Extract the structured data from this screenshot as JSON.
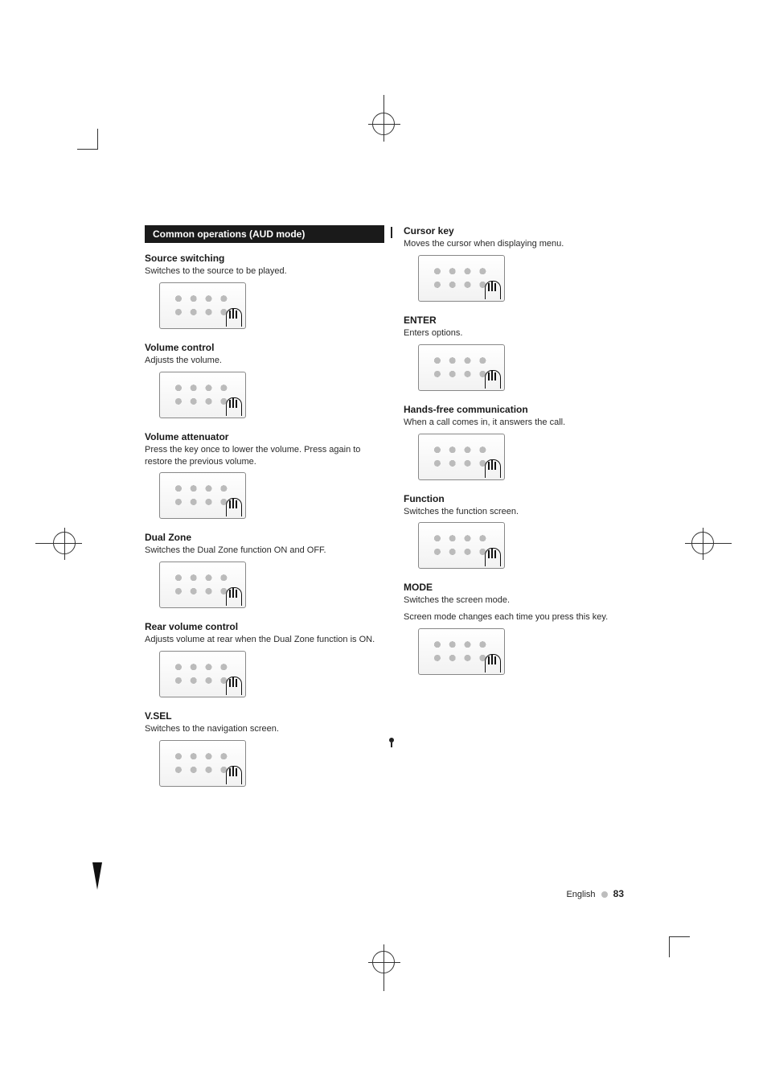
{
  "header": {
    "section_title": "Common operations (AUD mode)"
  },
  "left_column": [
    {
      "title": "Source switching",
      "desc": "Switches to the source to be played."
    },
    {
      "title": "Volume control",
      "desc": "Adjusts the volume."
    },
    {
      "title": "Volume attenuator",
      "desc": "Press the key once to lower the volume. Press again to restore the previous volume."
    },
    {
      "title": "Dual Zone",
      "desc": "Switches the Dual Zone function ON and OFF."
    },
    {
      "title": "Rear volume control",
      "desc": "Adjusts volume at rear when the Dual Zone function is ON."
    },
    {
      "title": "V.SEL",
      "desc": "Switches to the navigation screen."
    }
  ],
  "right_column": [
    {
      "title": "Cursor key",
      "desc": "Moves the cursor when displaying menu."
    },
    {
      "title": "ENTER",
      "desc": "Enters options."
    },
    {
      "title": "Hands-free communication",
      "desc": "When a call comes in, it answers the call."
    },
    {
      "title": "Function",
      "desc": "Switches the function screen."
    },
    {
      "title": "MODE",
      "desc": "Switches the screen mode.",
      "desc2": "Screen mode changes each time you press this key."
    }
  ],
  "footer": {
    "language": "English",
    "page": "83"
  }
}
